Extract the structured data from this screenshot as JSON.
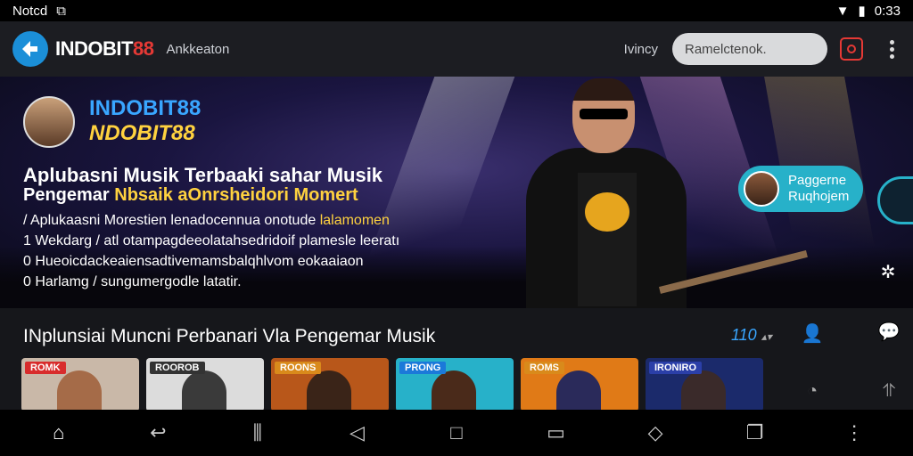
{
  "status_bar": {
    "carrier": "Notcd",
    "time": "0:33"
  },
  "app_bar": {
    "brand_white": "INDOBIT",
    "brand_red": "88",
    "subtitle": "Ankkeaton",
    "lang": "Ivincy",
    "search_placeholder": "Ramelctenok."
  },
  "hero": {
    "brand_line1": "INDOBIT88",
    "brand_line2": "NDOBIT88",
    "headline1": "Aplubasni Musik Terbaaki sahar Musik",
    "headline2_white": "Pengemar ",
    "headline2_yellow": "Nbsaik aOnrsheidori Momert",
    "bullets": [
      {
        "text": "/ Aplukaasni Morestien lenadocennua onotude ",
        "highlight": "lalamomen"
      },
      {
        "text": "1 Wekdarg / atl otampagdeeolatahsedridoif plamesle leeratı",
        "highlight": ""
      },
      {
        "text": "0 Hueoicdackeaiensadtivemamsbalqhlvom eokaaiaon",
        "highlight": ""
      },
      {
        "text": "0 Harlamg / sungumergodle latatir.",
        "highlight": ""
      }
    ],
    "promo_pill": {
      "line1": "Paggerne",
      "line2": "Ruqhojem"
    }
  },
  "section": {
    "title": "INplunsiai Muncni Perbanari Vla Pengemar Musik",
    "count": "110",
    "cards": [
      {
        "tag": "ROMK",
        "tag_color": "#d82c2c",
        "bg": "#c9b8a8",
        "fig": "#a56b48"
      },
      {
        "tag": "ROOROB",
        "tag_color": "#333333",
        "bg": "#dcdcdc",
        "fig": "#3a3a3a"
      },
      {
        "tag": "ROONS",
        "tag_color": "#d98a1b",
        "bg": "#b8571a",
        "fig": "#3a2418"
      },
      {
        "tag": "PRONG",
        "tag_color": "#1b79d9",
        "bg": "#27b1c9",
        "fig": "#4a2a1a"
      },
      {
        "tag": "ROMS",
        "tag_color": "#d98a1b",
        "bg": "#e07a17",
        "fig": "#2a2a5a"
      },
      {
        "tag": "IRONIRO",
        "tag_color": "#2b3fa8",
        "bg": "#1b2a6b",
        "fig": "#3a2a2a"
      }
    ]
  },
  "colors": {
    "accent_blue": "#39a6ff",
    "accent_red": "#e53935",
    "accent_yellow": "#ffd23f",
    "teal": "#27b1c9"
  }
}
